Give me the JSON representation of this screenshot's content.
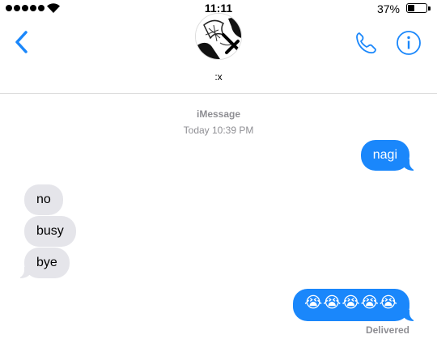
{
  "status_bar": {
    "time": "11:11",
    "battery_percent_label": "37%",
    "battery_level": 0.37
  },
  "header": {
    "contact_name": ":x",
    "accent_color": "#1a87fb"
  },
  "thread": {
    "service": "iMessage",
    "timestamp": "Today 10:39 PM"
  },
  "messages": [
    {
      "from": "me",
      "text": "nagi"
    },
    {
      "from": "them",
      "text": "no"
    },
    {
      "from": "them",
      "text": "busy"
    },
    {
      "from": "them",
      "text": "bye"
    },
    {
      "from": "me",
      "text": "😭😭😭😭😭"
    }
  ],
  "delivery_status": "Delivered",
  "colors": {
    "sent_bubble": "#1a87fb",
    "received_bubble": "#e5e5ea",
    "secondary_text": "#8e8e93"
  }
}
